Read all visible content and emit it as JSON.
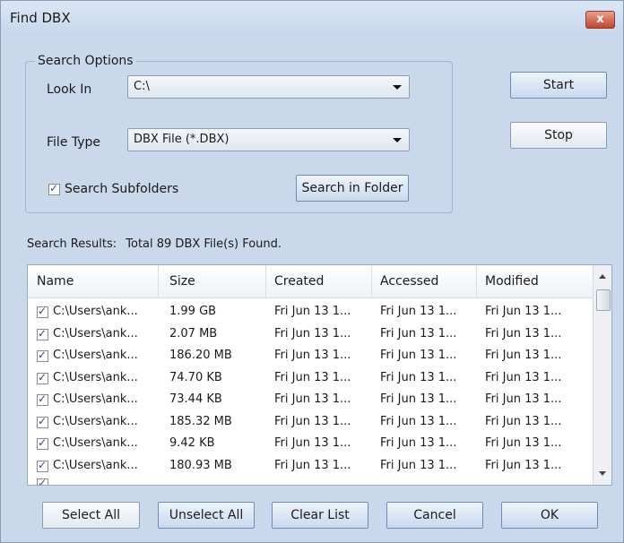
{
  "window": {
    "title": "Find DBX",
    "close_label": "x"
  },
  "options": {
    "legend": "Search Options",
    "look_in_label": "Look In",
    "look_in_value": "C:\\",
    "file_type_label": "File Type",
    "file_type_value": "DBX File (*.DBX)",
    "subfolders_label": "Search Subfolders",
    "subfolders_checked": true,
    "search_folder_button": "Search in Folder"
  },
  "actions": {
    "start": "Start",
    "stop": "Stop"
  },
  "results": {
    "label": "Search Results:",
    "count_text": "Total 89 DBX File(s) Found.",
    "columns": [
      "Name",
      "Size",
      "Created",
      "Accessed",
      "Modified"
    ],
    "rows": [
      {
        "name": "C:\\Users\\ank...",
        "size": "1.99 GB",
        "created": "Fri Jun 13 1...",
        "accessed": "Fri Jun 13 1...",
        "modified": "Fri Jun 13 1..."
      },
      {
        "name": "C:\\Users\\ank...",
        "size": "2.07 MB",
        "created": "Fri Jun 13 1...",
        "accessed": "Fri Jun 13 1...",
        "modified": "Fri Jun 13 1..."
      },
      {
        "name": "C:\\Users\\ank...",
        "size": "186.20 MB",
        "created": "Fri Jun 13 1...",
        "accessed": "Fri Jun 13 1...",
        "modified": "Fri Jun 13 1..."
      },
      {
        "name": "C:\\Users\\ank...",
        "size": "74.70 KB",
        "created": "Fri Jun 13 1...",
        "accessed": "Fri Jun 13 1...",
        "modified": "Fri Jun 13 1..."
      },
      {
        "name": "C:\\Users\\ank...",
        "size": "73.44 KB",
        "created": "Fri Jun 13 1...",
        "accessed": "Fri Jun 13 1...",
        "modified": "Fri Jun 13 1..."
      },
      {
        "name": "C:\\Users\\ank...",
        "size": "185.32 MB",
        "created": "Fri Jun 13 1...",
        "accessed": "Fri Jun 13 1...",
        "modified": "Fri Jun 13 1..."
      },
      {
        "name": "C:\\Users\\ank...",
        "size": "9.42 KB",
        "created": "Fri Jun 13 1...",
        "accessed": "Fri Jun 13 1...",
        "modified": "Fri Jun 13 1..."
      },
      {
        "name": "C:\\Users\\ank...",
        "size": "180.93 MB",
        "created": "Fri Jun 13 1...",
        "accessed": "Fri Jun 13 1...",
        "modified": "Fri Jun 13 1..."
      }
    ]
  },
  "footer": {
    "select_all": "Select All",
    "unselect_all": "Unselect All",
    "clear_list": "Clear List",
    "cancel": "Cancel",
    "ok": "OK"
  },
  "colors": {
    "background": "#dbe6f2",
    "close_button": "#c4432b",
    "button_blue": "#c8d9ee"
  }
}
